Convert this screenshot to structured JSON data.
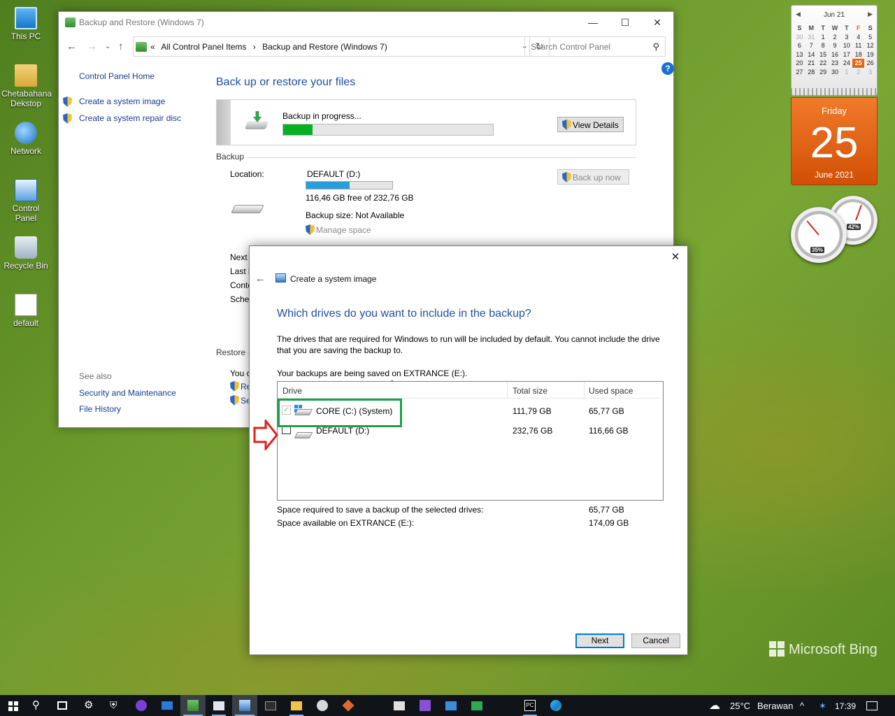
{
  "desktop": {
    "icons": [
      {
        "label": "This PC",
        "icon": "computer-icon"
      },
      {
        "label": "Chetabahana Dekstop",
        "icon": "user-folder-icon"
      },
      {
        "label": "Network",
        "icon": "network-icon"
      },
      {
        "label": "Control Panel",
        "icon": "control-panel-icon"
      },
      {
        "label": "Recycle Bin",
        "icon": "recycle-bin-icon"
      },
      {
        "label": "default",
        "icon": "image-file-icon"
      }
    ],
    "watermark": "Microsoft Bing"
  },
  "main_window": {
    "title": "Backup and Restore (Windows 7)",
    "breadcrumbs": [
      "«",
      "All Control Panel Items",
      "›",
      "Backup and Restore (Windows 7)"
    ],
    "search_placeholder": "Search Control Panel",
    "help": "?",
    "left_pane": {
      "home": "Control Panel Home",
      "tasks": [
        "Create a system image",
        "Create a system repair disc"
      ],
      "see_also_label": "See also",
      "see_also": [
        "Security and Maintenance",
        "File History"
      ]
    },
    "page_title": "Back up or restore your files",
    "progress": {
      "label": "Backup in progress...",
      "fraction": 0.14,
      "view_details": "View Details"
    },
    "backup_section": {
      "header": "Backup",
      "location_label": "Location:",
      "location_value": "DEFAULT (D:)",
      "location_used_fraction": 0.5,
      "free_text": "116,46 GB free of 232,76 GB",
      "size_text": "Backup size: Not Available",
      "manage_space": "Manage space",
      "back_up_now": "Back up now",
      "truncated_labels": [
        "Next",
        "Last b",
        "Conte",
        "Schec"
      ]
    },
    "restore_section": {
      "header": "Restore",
      "truncated": [
        "You c",
        "Re",
        "Se"
      ]
    }
  },
  "dialog": {
    "title": "Create a system image",
    "heading": "Which drives do you want to include in the backup?",
    "description": "The drives that are required for Windows to run will be included by default. You cannot include the drive that you are saving the backup to.",
    "saved_to": "Your backups are being saved on EXTRANCE (E:).",
    "columns": [
      "Drive",
      "Total size",
      "Used space"
    ],
    "drives": [
      {
        "name": "CORE (C:) (System)",
        "total": "111,79 GB",
        "used": "65,77 GB",
        "checked": true,
        "disabled": true
      },
      {
        "name": "DEFAULT (D:)",
        "total": "232,76 GB",
        "used": "116,66 GB",
        "checked": false,
        "disabled": false
      }
    ],
    "space_required_label": "Space required to save a backup of the selected drives:",
    "space_required_value": "65,77 GB",
    "space_available_label": "Space available on EXTRANCE (E:):",
    "space_available_value": "174,09 GB",
    "buttons": {
      "next": "Next",
      "cancel": "Cancel"
    },
    "annotation_colors": {
      "highlight": "#19a04a",
      "arrow": "#e02020"
    }
  },
  "calendar_gadget": {
    "month_label": "Jun 21",
    "weekdays": [
      "S",
      "M",
      "T",
      "W",
      "T",
      "F",
      "S"
    ],
    "weeks": [
      [
        "30",
        "31",
        "1",
        "2",
        "3",
        "4",
        "5"
      ],
      [
        "6",
        "7",
        "8",
        "9",
        "10",
        "11",
        "12"
      ],
      [
        "13",
        "14",
        "15",
        "16",
        "17",
        "18",
        "19"
      ],
      [
        "20",
        "21",
        "22",
        "23",
        "24",
        "25",
        "26"
      ],
      [
        "27",
        "28",
        "29",
        "30",
        "1",
        "2",
        "3"
      ]
    ],
    "today": "25",
    "day_name": "Friday",
    "day_number": "25",
    "month_year": "June 2021"
  },
  "cpu_gadget": {
    "cpu_percent": "35%",
    "memory_percent": "42%"
  },
  "taskbar": {
    "weather": "25°C",
    "weather_text": "Berawan",
    "chevron": "^",
    "time": "17:39",
    "items": [
      "start",
      "search",
      "task-view",
      "settings",
      "security",
      "github",
      "mail",
      "backup",
      "calendar-app",
      "control-panel",
      "terminal",
      "explorer",
      "cloud",
      "git",
      "store",
      "visual-studio",
      "remote",
      "chat",
      "pycharm",
      "edge"
    ],
    "colors": {
      "accent": "#0078d7",
      "orange": "#e8660f"
    }
  }
}
